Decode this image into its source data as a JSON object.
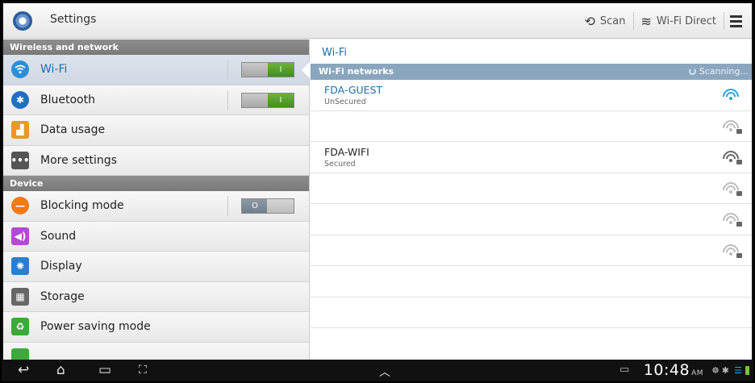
{
  "actionbar": {
    "title": "Settings",
    "scan_label": "Scan",
    "wifi_direct_label": "Wi-Fi Direct"
  },
  "left": {
    "sections": [
      {
        "title": "Wireless and network"
      },
      {
        "title": "Device"
      }
    ],
    "items": [
      {
        "label": "Wi-Fi",
        "icon": "wifi-icon",
        "toggle": "on",
        "toggle_text": "I"
      },
      {
        "label": "Bluetooth",
        "icon": "bluetooth-icon",
        "toggle": "on",
        "toggle_text": "I"
      },
      {
        "label": "Data usage",
        "icon": "data-usage-icon"
      },
      {
        "label": "More settings",
        "icon": "more-settings-icon"
      },
      {
        "label": "Blocking mode",
        "icon": "blocking-mode-icon",
        "toggle": "off",
        "toggle_text": "O"
      },
      {
        "label": "Sound",
        "icon": "sound-icon"
      },
      {
        "label": "Display",
        "icon": "display-icon"
      },
      {
        "label": "Storage",
        "icon": "storage-icon"
      },
      {
        "label": "Power saving mode",
        "icon": "power-saving-icon"
      }
    ]
  },
  "right": {
    "title": "Wi-Fi",
    "networks_header": "Wi-Fi networks",
    "scanning": "Scanning...",
    "networks": [
      {
        "name": "FDA-GUEST",
        "status": "UnSecured"
      },
      {
        "name": "",
        "status": ""
      },
      {
        "name": "FDA-WIFI",
        "status": "Secured"
      },
      {
        "name": "",
        "status": ""
      },
      {
        "name": "",
        "status": ""
      },
      {
        "name": "",
        "status": ""
      }
    ]
  },
  "navbar": {
    "time": "10:48",
    "ampm": "AM"
  },
  "colors": {
    "accent": "#1d6ea8",
    "toggle_on": "#4f9f28",
    "header_blue": "#8aa6bf"
  }
}
